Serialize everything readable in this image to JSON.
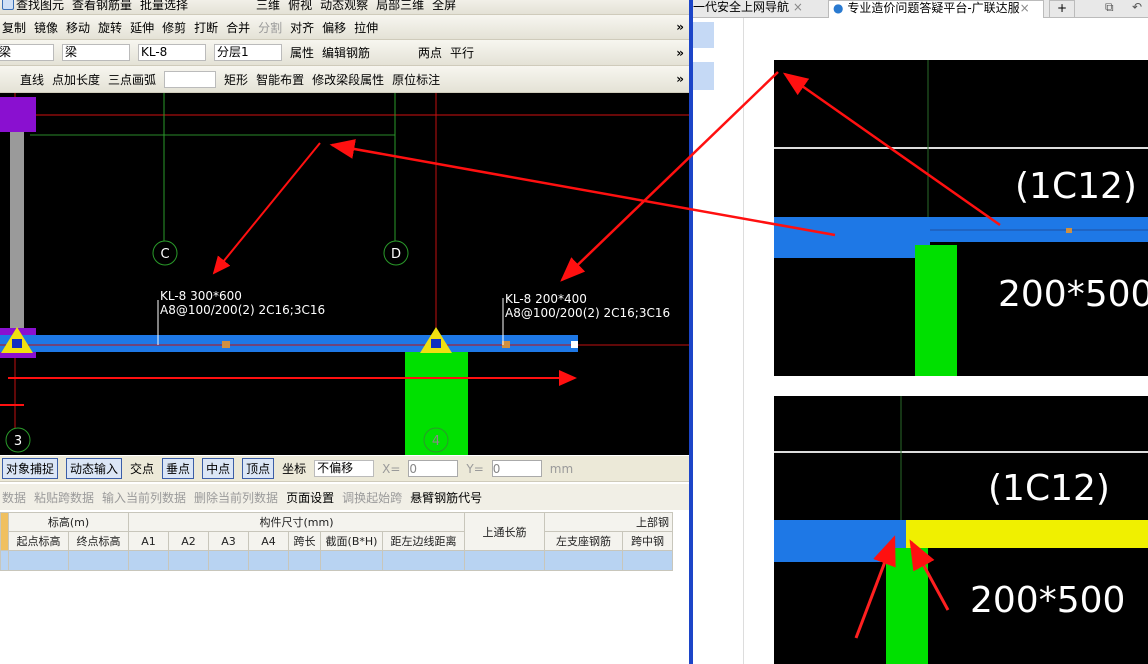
{
  "toolbar1": [
    "查找图元",
    "查看钢筋量",
    "批量选择",
    "三维",
    "俯视",
    "动态观察",
    "局部三维",
    "全屏"
  ],
  "toolbar2": [
    "复制",
    "镜像",
    "移动",
    "旋转",
    "延伸",
    "修剪",
    "打断",
    "合并",
    "分割",
    "对齐",
    "偏移",
    "拉伸"
  ],
  "toolbar3": {
    "sel1": "梁",
    "sel2": "梁",
    "sel3": "KL-8",
    "sel4": "分层1",
    "attr": "属性",
    "edit": "编辑钢筋",
    "two_point": "两点",
    "parallel": "平行"
  },
  "toolbar4": [
    "直线",
    "点加长度",
    "三点画弧",
    "矩形",
    "智能布置",
    "修改梁段属性",
    "原位标注"
  ],
  "canvas": {
    "axis_c": "C",
    "axis_d": "D",
    "axis_3": "3",
    "axis_4": "4",
    "beam1_label": "KL-8 300*600",
    "beam1_rebar": "A8@100/200(2) 2C16;3C16",
    "beam2_label": "KL-8 200*400",
    "beam2_rebar": "A8@100/200(2) 2C16;3C16"
  },
  "snap": {
    "items": [
      "对象捕捉",
      "动态输入",
      "交点",
      "垂点",
      "中点",
      "顶点",
      "坐标"
    ],
    "offset": "不偏移",
    "x_label": "X=",
    "x_value": "0",
    "y_label": "Y=",
    "y_value": "0",
    "unit": "mm"
  },
  "table_toolbar": [
    {
      "label": "数据",
      "enabled": false
    },
    {
      "label": "粘贴跨数据",
      "enabled": false
    },
    {
      "label": "输入当前列数据",
      "enabled": false
    },
    {
      "label": "删除当前列数据",
      "enabled": false
    },
    {
      "label": "页面设置",
      "enabled": true
    },
    {
      "label": "调换起始跨",
      "enabled": false
    },
    {
      "label": "悬臂钢筋代号",
      "enabled": true
    }
  ],
  "table": {
    "group1": "标高(m)",
    "group2": "构件尺寸(mm)",
    "group3": "上通长筋",
    "group4": "上部钢",
    "cols": [
      "起点标高",
      "终点标高",
      "A1",
      "A2",
      "A3",
      "A4",
      "跨长",
      "截面(B*H)",
      "距左边线距离",
      "左支座钢筋",
      "跨中钢"
    ]
  },
  "browser": {
    "tab1": "一代安全上网导航",
    "tab2": "专业造价问题答疑平台-广联达服",
    "new_tab": "+"
  },
  "figure1": {
    "rebar": "(1C12)",
    "size": "200*500"
  },
  "figure2": {
    "rebar": "(1C12)",
    "size": "200*500"
  },
  "colors": {
    "beam": "#1e78e6",
    "column": "#00e000",
    "annotation_arrow": "#ff1010",
    "divider": "#1c45c8"
  }
}
